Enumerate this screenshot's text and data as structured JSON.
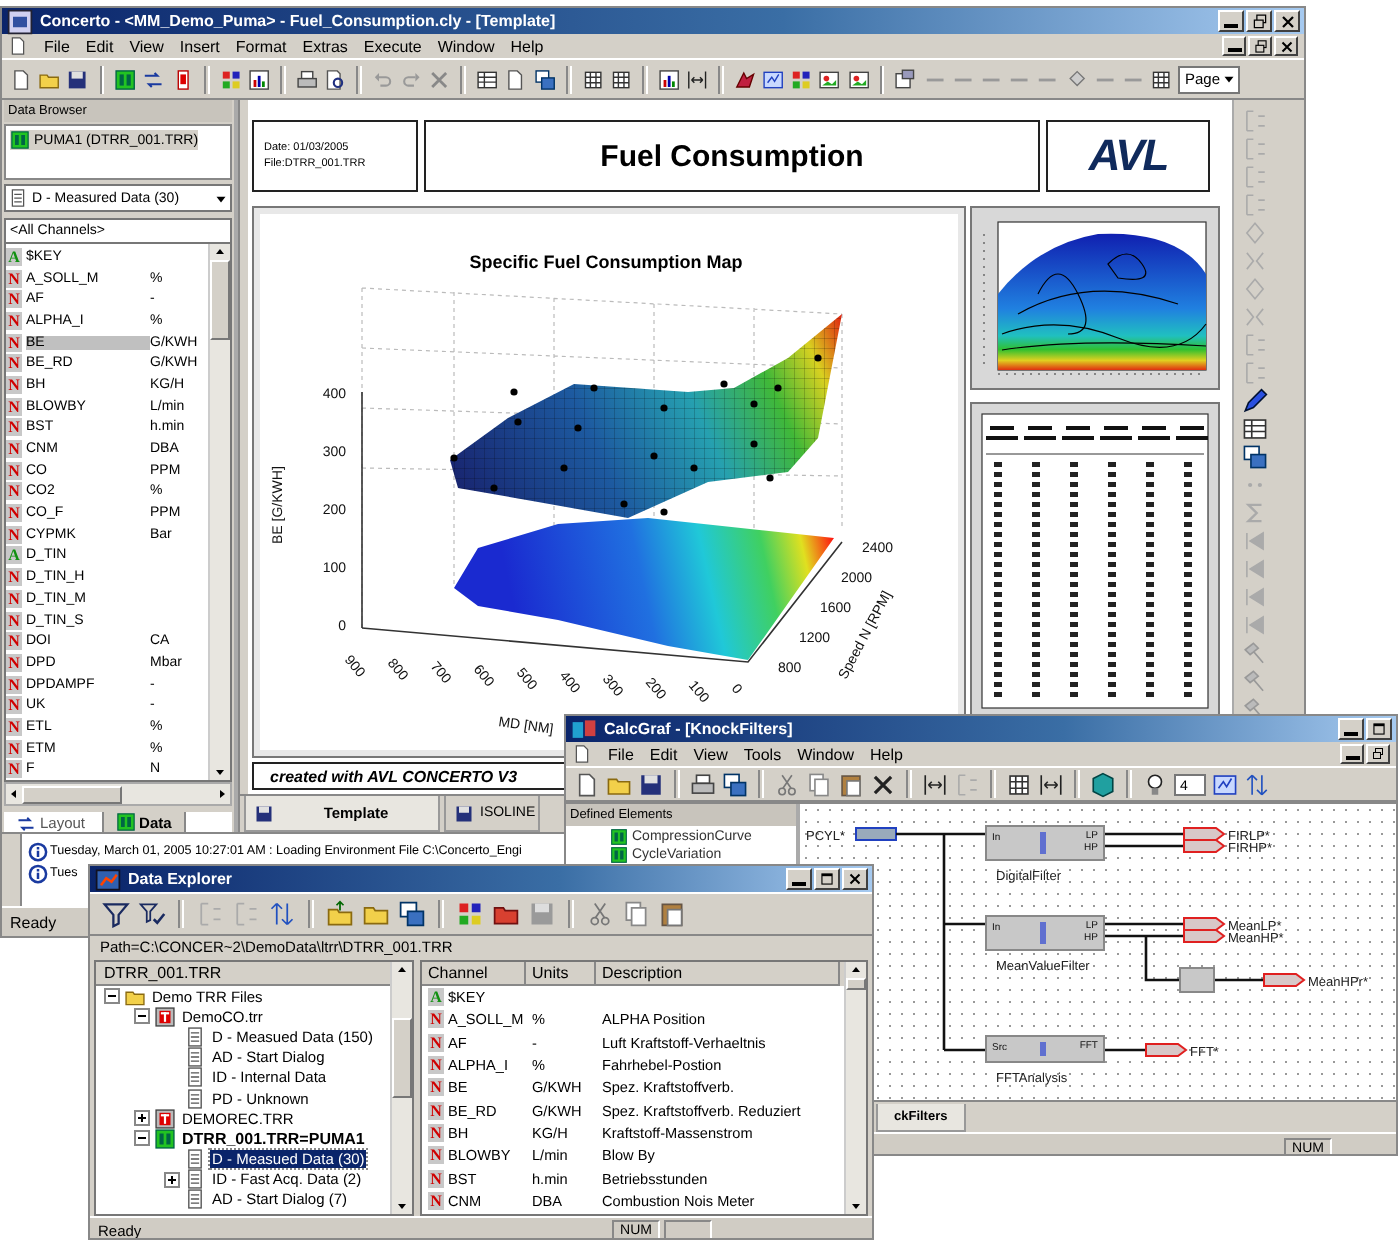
{
  "main_window": {
    "title": "Concerto - <MM_Demo_Puma> - Fuel_Consumption.cly - [Template]",
    "menu": [
      "File",
      "Edit",
      "View",
      "Insert",
      "Format",
      "Extras",
      "Execute",
      "Window",
      "Help"
    ],
    "page_dropdown": "Page",
    "log": [
      "Tuesday, March 01, 2005 10:27:01 AM : Loading Environment File C:\\Concerto_Engi",
      "Tues"
    ],
    "status": "Ready"
  },
  "data_browser": {
    "title": "Data Browser",
    "device": "PUMA1 (DTRR_001.TRR)",
    "dataset": "D - Measured Data (30)",
    "filter": "<All Channels>",
    "channels": [
      {
        "kind": "alpha",
        "badge": "A",
        "name": "$KEY",
        "selected": false
      },
      {
        "kind": "numeric",
        "badge": "N",
        "name": "A_SOLL_M",
        "unit": "%",
        "selected": false
      },
      {
        "kind": "numeric",
        "badge": "N",
        "name": "AF",
        "unit": "-",
        "selected": false
      },
      {
        "kind": "numeric",
        "badge": "N",
        "name": "ALPHA_I",
        "unit": "%",
        "selected": false
      },
      {
        "kind": "numeric",
        "badge": "N",
        "name": "BE",
        "unit": "G/KWH",
        "selected": true
      },
      {
        "kind": "numeric",
        "badge": "N",
        "name": "BE_RD",
        "unit": "G/KWH",
        "selected": false
      },
      {
        "kind": "numeric",
        "badge": "N",
        "name": "BH",
        "unit": "KG/H",
        "selected": false
      },
      {
        "kind": "numeric",
        "badge": "N",
        "name": "BLOWBY",
        "unit": "L/min",
        "selected": false
      },
      {
        "kind": "numeric",
        "badge": "N",
        "name": "BST",
        "unit": "h.min",
        "selected": false
      },
      {
        "kind": "numeric",
        "badge": "N",
        "name": "CNM",
        "unit": "DBA",
        "selected": false
      },
      {
        "kind": "numeric",
        "badge": "N",
        "name": "CO",
        "unit": "PPM",
        "selected": false
      },
      {
        "kind": "numeric",
        "badge": "N",
        "name": "CO2",
        "unit": "%",
        "selected": false
      },
      {
        "kind": "numeric",
        "badge": "N",
        "name": "CO_F",
        "unit": "PPM",
        "selected": false
      },
      {
        "kind": "numeric",
        "badge": "N",
        "name": "CYPMK",
        "unit": "Bar",
        "selected": false
      },
      {
        "kind": "alpha",
        "badge": "A",
        "name": "D_TIN",
        "selected": false
      },
      {
        "kind": "numeric",
        "badge": "N",
        "name": "D_TIN_H",
        "selected": false
      },
      {
        "kind": "numeric",
        "badge": "N",
        "name": "D_TIN_M",
        "selected": false
      },
      {
        "kind": "numeric",
        "badge": "N",
        "name": "D_TIN_S",
        "selected": false
      },
      {
        "kind": "numeric",
        "badge": "N",
        "name": "DOI",
        "unit": "CA",
        "selected": false
      },
      {
        "kind": "numeric",
        "badge": "N",
        "name": "DPD",
        "unit": "Mbar",
        "selected": false
      },
      {
        "kind": "numeric",
        "badge": "N",
        "name": "DPDAMPF",
        "unit": "-",
        "selected": false
      },
      {
        "kind": "numeric",
        "badge": "N",
        "name": "UK",
        "unit": "-",
        "selected": false
      },
      {
        "kind": "numeric",
        "badge": "N",
        "name": "ETL",
        "unit": "%",
        "selected": false
      },
      {
        "kind": "numeric",
        "badge": "N",
        "name": "ETM",
        "unit": "%",
        "selected": false
      },
      {
        "kind": "numeric",
        "badge": "N",
        "name": "F",
        "unit": "N",
        "selected": false
      }
    ],
    "tabs": [
      {
        "label": "Layout",
        "selected": false
      },
      {
        "label": "Data",
        "selected": true
      }
    ]
  },
  "report": {
    "date": "Date: 01/03/2005",
    "file": "File:DTRR_001.TRR",
    "title": "Fuel Consumption",
    "logo": "AVL",
    "chart": {
      "title": "Specific Fuel Consumption Map",
      "z_label": "BE [G/KWH]",
      "z_ticks": [
        "400",
        "300",
        "200",
        "100",
        "0"
      ],
      "x_label": "MD [NM]",
      "x_ticks": [
        "900",
        "800",
        "700",
        "600",
        "500",
        "400",
        "300",
        "200",
        "100",
        "0"
      ],
      "y_label": "Speed N [RPM]",
      "y_ticks": [
        "800",
        "1200",
        "1600",
        "2000",
        "2400"
      ]
    },
    "footer": "created with AVL CONCERTO V3"
  },
  "document_tabs": [
    {
      "label": "Template",
      "selected": true
    },
    {
      "label": "ISOLINE",
      "selected": false
    }
  ],
  "calcgraf": {
    "title": "CalcGraf - [KnockFilters]",
    "menu": [
      "File",
      "Edit",
      "View",
      "Tools",
      "Window",
      "Help"
    ],
    "zoom_value": "4",
    "panel_title": "Defined Elements",
    "elements": [
      "CompressionCurve",
      "CycleVariation"
    ],
    "input": "PCYL*",
    "blocks": [
      {
        "name": "DigitalFilter",
        "inputs": [
          "In"
        ],
        "outputs": [
          "LP",
          "HP"
        ]
      },
      {
        "name": "MeanValueFilter",
        "inputs": [
          "In"
        ],
        "outputs": [
          "LP",
          "HP"
        ]
      },
      {
        "name": "FFTAnalysis",
        "inputs": [
          "Src"
        ],
        "outputs": [
          "FFT"
        ]
      }
    ],
    "outputs": [
      "FIRLP*",
      "FIRHP*",
      "MeanLP*",
      "MeanHP*",
      "MeanHPr*",
      "FFT*"
    ],
    "tab": "ckFilters",
    "indicator": "NUM"
  },
  "data_explorer": {
    "title": "Data Explorer",
    "path": "Path=C:\\CONCER~2\\DemoData\\ltrr\\DTRR_001.TRR",
    "tree_header": "DTRR_001.TRR",
    "tree": [
      {
        "label": "Demo TRR Files",
        "kind": "folder",
        "expanded": true,
        "selected": false,
        "children": [
          {
            "label": "DemoCO.trr",
            "kind": "file",
            "expanded": true,
            "selected": false,
            "children": [
              {
                "label": "D - Measued Data (150)",
                "kind": "dataset",
                "selected": false
              },
              {
                "label": "AD - Start Dialog",
                "kind": "dataset",
                "selected": false
              },
              {
                "label": "ID - Internal Data",
                "kind": "dataset",
                "selected": false
              },
              {
                "label": "PD - Unknown",
                "kind": "dataset",
                "selected": false
              }
            ]
          },
          {
            "label": "DEMOREC.TRR",
            "kind": "file",
            "expanded": false,
            "selected": false
          },
          {
            "label": "DTRR_001.TRR=PUMA1",
            "kind": "device",
            "expanded": true,
            "selected": false,
            "children": [
              {
                "label": "D - Measued Data (30)",
                "kind": "dataset",
                "selected": true
              },
              {
                "label": "ID - Fast Acq. Data (2)",
                "kind": "dataset",
                "expanded": false,
                "selected": false
              },
              {
                "label": "AD - Start Dialog (7)",
                "kind": "dataset",
                "selected": false
              }
            ]
          }
        ]
      }
    ],
    "columns": [
      "Channel",
      "Units",
      "Description"
    ],
    "rows": [
      {
        "kind": "alpha",
        "badge": "A",
        "channel": "$KEY"
      },
      {
        "kind": "numeric",
        "badge": "N",
        "channel": "A_SOLL_M",
        "units": "%",
        "description": "ALPHA Position"
      },
      {
        "kind": "numeric",
        "badge": "N",
        "channel": "AF",
        "units": "-",
        "description": "Luft Kraftstoff-Verhaeltnis"
      },
      {
        "kind": "numeric",
        "badge": "N",
        "channel": "ALPHA_I",
        "units": "%",
        "description": "Fahrhebel-Postion"
      },
      {
        "kind": "numeric",
        "badge": "N",
        "channel": "BE",
        "units": "G/KWH",
        "description": "Spez. Kraftstoffverb."
      },
      {
        "kind": "numeric",
        "badge": "N",
        "channel": "BE_RD",
        "units": "G/KWH",
        "description": "Spez. Kraftstoffverb. Reduziert"
      },
      {
        "kind": "numeric",
        "badge": "N",
        "channel": "BH",
        "units": "KG/H",
        "description": "Kraftstoff-Massenstrom"
      },
      {
        "kind": "numeric",
        "badge": "N",
        "channel": "BLOWBY",
        "units": "L/min",
        "description": "Blow By"
      },
      {
        "kind": "numeric",
        "badge": "N",
        "channel": "BST",
        "units": "h.min",
        "description": "Betriebsstunden"
      },
      {
        "kind": "numeric",
        "badge": "N",
        "channel": "CNM",
        "units": "DBA",
        "description": "Combustion Nois Meter"
      }
    ],
    "status": "Ready",
    "indicator": "NUM"
  }
}
